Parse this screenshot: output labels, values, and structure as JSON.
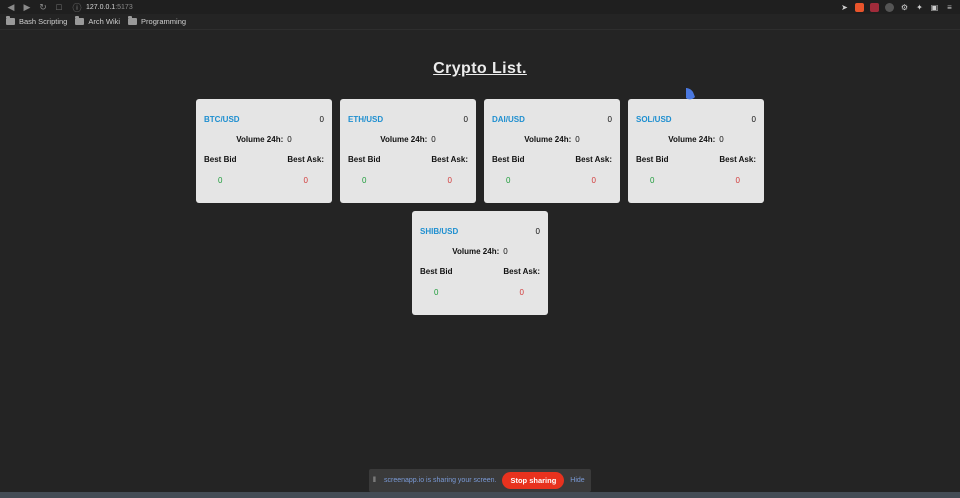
{
  "browser": {
    "url_host": "127.0.0.1",
    "url_port": ":5173"
  },
  "bookmarks": [
    {
      "label": "Bash Scripting"
    },
    {
      "label": "Arch Wiki"
    },
    {
      "label": "Programming"
    }
  ],
  "page": {
    "title": "Crypto List."
  },
  "cards": [
    {
      "symbol": "BTC/USD",
      "price": "0",
      "volume_label": "Volume 24h:",
      "volume": "0",
      "bid_label": "Best Bid",
      "ask_label": "Best Ask:",
      "bid": "0",
      "ask": "0"
    },
    {
      "symbol": "ETH/USD",
      "price": "0",
      "volume_label": "Volume 24h:",
      "volume": "0",
      "bid_label": "Best Bid",
      "ask_label": "Best Ask:",
      "bid": "0",
      "ask": "0"
    },
    {
      "symbol": "DAI/USD",
      "price": "0",
      "volume_label": "Volume 24h:",
      "volume": "0",
      "bid_label": "Best Bid",
      "ask_label": "Best Ask:",
      "bid": "0",
      "ask": "0"
    },
    {
      "symbol": "SOL/USD",
      "price": "0",
      "volume_label": "Volume 24h:",
      "volume": "0",
      "bid_label": "Best Bid",
      "ask_label": "Best Ask:",
      "bid": "0",
      "ask": "0"
    },
    {
      "symbol": "SHIB/USD",
      "price": "0",
      "volume_label": "Volume 24h:",
      "volume": "0",
      "bid_label": "Best Bid",
      "ask_label": "Best Ask:",
      "bid": "0",
      "ask": "0"
    }
  ],
  "share_bar": {
    "message": "screenapp.io is sharing your screen.",
    "stop_label": "Stop sharing",
    "hide_label": "Hide"
  },
  "colors": {
    "symbol": "#1e8fd0",
    "bid": "#1e9c3b",
    "ask": "#d23a3a",
    "stop_button": "#e8321e"
  }
}
